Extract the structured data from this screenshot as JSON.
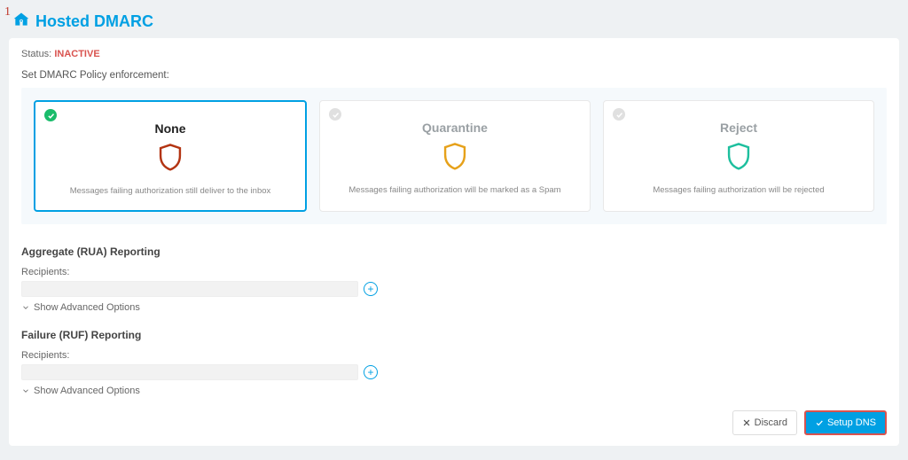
{
  "step_indicator": "1",
  "header": {
    "title": "Hosted DMARC"
  },
  "status": {
    "label": "Status:",
    "value": "INACTIVE"
  },
  "policy": {
    "label": "Set DMARC Policy enforcement:",
    "options": [
      {
        "title": "None",
        "desc": "Messages failing authorization still deliver to the inbox",
        "selected": true,
        "shield_color": "#b33412"
      },
      {
        "title": "Quarantine",
        "desc": "Messages failing authorization will be marked as a Spam",
        "selected": false,
        "shield_color": "#e6a11a"
      },
      {
        "title": "Reject",
        "desc": "Messages failing authorization will be rejected",
        "selected": false,
        "shield_color": "#1dbf9e"
      }
    ]
  },
  "rua": {
    "heading": "Aggregate (RUA) Reporting",
    "recipients_label": "Recipients:",
    "value": "",
    "advanced": "Show Advanced Options"
  },
  "ruf": {
    "heading": "Failure (RUF) Reporting",
    "recipients_label": "Recipients:",
    "value": "",
    "advanced": "Show Advanced Options"
  },
  "footer": {
    "discard": "Discard",
    "setup": "Setup DNS"
  }
}
